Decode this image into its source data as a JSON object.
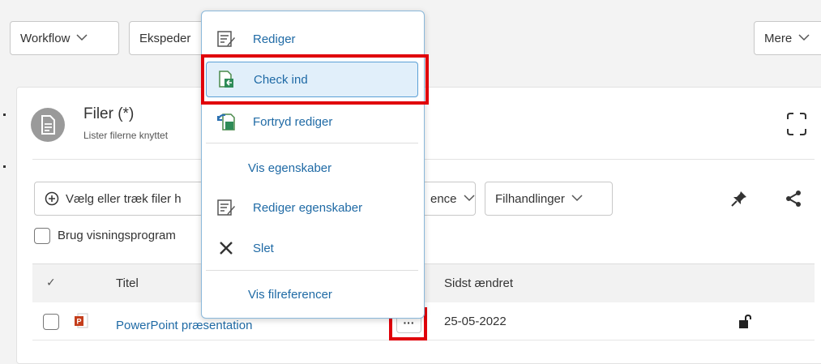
{
  "toolbar": {
    "workflow_label": "Workflow",
    "ekspeder_label": "Ekspeder",
    "mere_label": "Mere"
  },
  "panel": {
    "title": "Filer (*)",
    "subtitle": "Lister filerne knyttet",
    "add_files_label": "Vælg eller træk filer h",
    "sequence_label": "ence",
    "file_actions_label": "Filhandlinger",
    "viewer_label": "Brug visningsprogram"
  },
  "table": {
    "headers": {
      "check": "✓",
      "title": "Titel",
      "modified": "Sidst ændret"
    },
    "rows": [
      {
        "title": "PowerPoint præsentation",
        "modified": "25-05-2022",
        "more": "···"
      }
    ]
  },
  "menu": {
    "items": [
      {
        "label": "Rediger",
        "icon": "edit-document-icon"
      },
      {
        "label": "Check ind",
        "icon": "check-in-icon"
      },
      {
        "label": "Fortryd rediger",
        "icon": "undo-edit-icon"
      },
      {
        "label": "Vis egenskaber",
        "icon": ""
      },
      {
        "label": "Rediger egenskaber",
        "icon": "edit-properties-icon"
      },
      {
        "label": "Slet",
        "icon": "delete-icon"
      },
      {
        "label": "Vis filreferencer",
        "icon": ""
      }
    ]
  },
  "colors": {
    "link": "#1f6aa5",
    "highlight": "#e1effa",
    "annotation_red": "#e0000a"
  }
}
